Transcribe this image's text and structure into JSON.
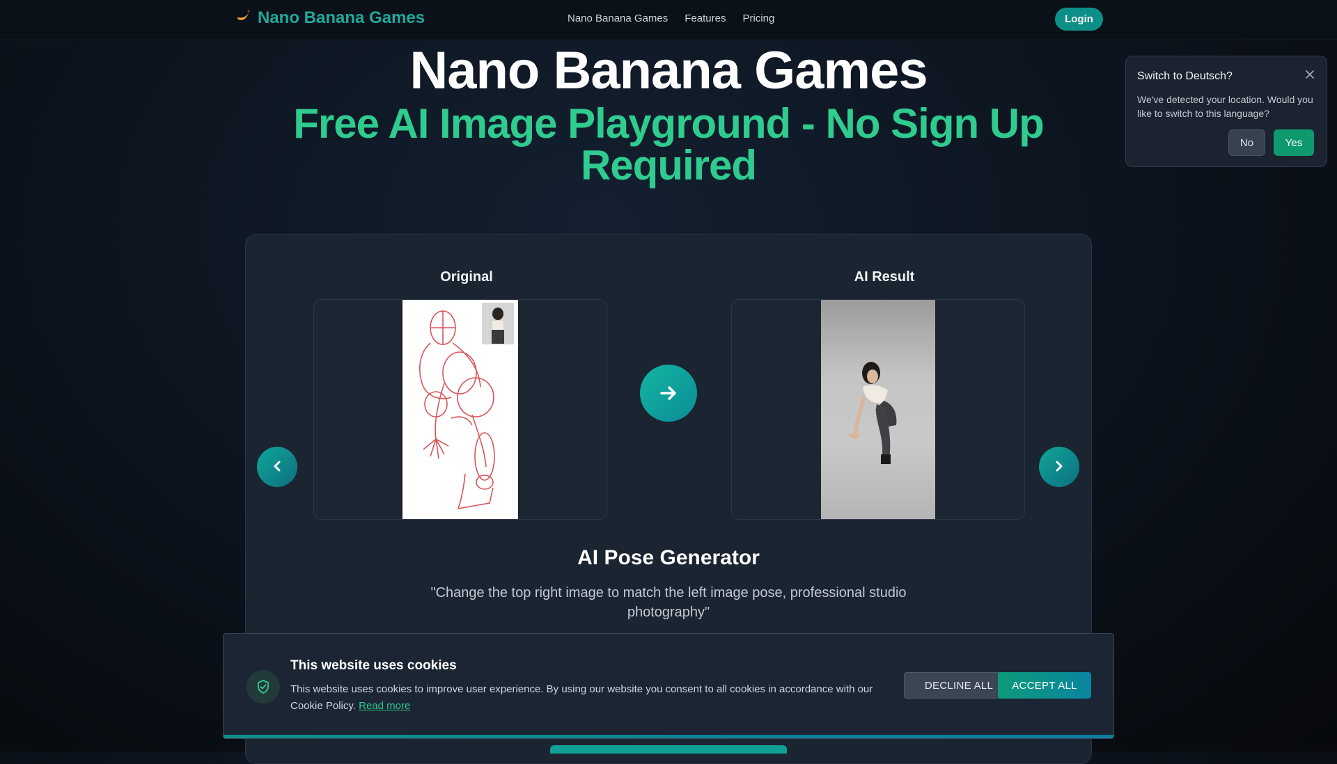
{
  "header": {
    "brand_name": "Nano Banana Games",
    "brand_icon": "banana-icon",
    "nav": [
      "Nano Banana Games",
      "Features",
      "Pricing"
    ],
    "login_label": "Login"
  },
  "hero": {
    "title": "Nano Banana Games",
    "subtitle": "Free AI Image Playground - No Sign Up Required"
  },
  "showcase": {
    "original_label": "Original",
    "result_label": "AI Result",
    "feature_title": "AI Pose Generator",
    "prompt": "\"Change the top right image to match the left image pose, professional studio photography\""
  },
  "language_popup": {
    "title": "Switch to Deutsch?",
    "message": "We've detected your location. Would you like to switch to this language?",
    "no_label": "No",
    "yes_label": "Yes"
  },
  "cookie_banner": {
    "title": "This website uses cookies",
    "body": "This website uses cookies to improve user experience. By using our website you consent to all cookies in accordance with our Cookie Policy.",
    "read_more": "Read more",
    "decline_label": "DECLINE ALL",
    "accept_label": "ACCEPT ALL"
  },
  "colors": {
    "accent_teal": "#0d8f88",
    "subtitle_green": "#2fcb8f",
    "background": "#0d1520",
    "card": "#1b2431"
  }
}
